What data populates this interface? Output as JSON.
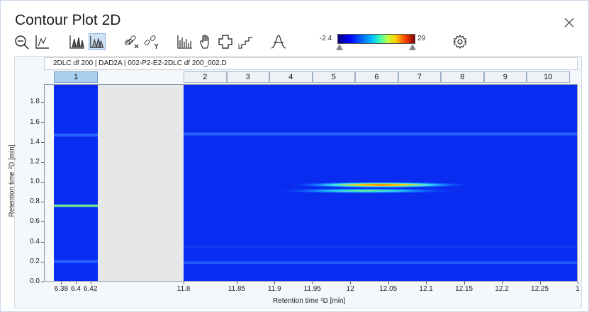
{
  "window": {
    "title": "Contour Plot 2D"
  },
  "toolbar": {
    "buttons": [
      {
        "name": "zoom-out-icon"
      },
      {
        "name": "axis-settings-icon"
      },
      {
        "name": "overlay-peaks-icon"
      },
      {
        "name": "stacked-peaks-icon",
        "active": true
      },
      {
        "name": "link-x-icon"
      },
      {
        "name": "link-y-icon"
      },
      {
        "name": "bar-spectrum-icon"
      },
      {
        "name": "pan-hand-icon"
      },
      {
        "name": "zoom-region-icon"
      },
      {
        "name": "step-icon"
      },
      {
        "name": "peak-icon"
      },
      {
        "name": "gear-icon"
      }
    ],
    "colorbar": {
      "min_label": "-2.4",
      "max_label": "29"
    }
  },
  "plot": {
    "info": "2DLC df 200 | DAD2A | 002-P2-E2-2DLC df 200_002.D",
    "tabs": [
      "1",
      "2",
      "3",
      "4",
      "5",
      "6",
      "7",
      "8",
      "9",
      "10"
    ],
    "selected_tab": "1",
    "ylabel": "Retention time ²D [min]",
    "xlabel": "Retention time ¹D [min]",
    "yticks": [
      "1.8",
      "1.6",
      "1.4",
      "1.2",
      "1.0",
      "0.8",
      "0.6",
      "0.4",
      "0.2",
      "0.0"
    ],
    "xticks_left": [
      "6.38",
      "6.4",
      "6.42"
    ],
    "xticks_right": [
      "11.8",
      "11.85",
      "11.9",
      "11.95",
      "12",
      "12.05",
      "12.1",
      "12.15",
      "12.2",
      "12.25",
      "1"
    ]
  },
  "chart_data": {
    "type": "heatmap",
    "xlabel": "Retention time ¹D [min]",
    "ylabel": "Retention time ²D [min]",
    "ylim": [
      0.0,
      1.98
    ],
    "color_range": [
      -2.4,
      29
    ],
    "segments": [
      {
        "tab": "1",
        "xlim": [
          6.37,
          6.43
        ]
      },
      {
        "tab": "2-10",
        "xlim": [
          11.78,
          12.3
        ]
      }
    ],
    "bands": [
      {
        "segment": "1",
        "y": 0.76,
        "intensity": "medium-high"
      },
      {
        "segment": "1",
        "y": 1.47,
        "intensity": "low"
      },
      {
        "segment": "1",
        "y": 0.2,
        "intensity": "low"
      },
      {
        "segment": "2-10",
        "y": 0.97,
        "x_range": [
          11.95,
          12.12
        ],
        "peak_x": 12.04,
        "intensity": "high"
      },
      {
        "segment": "2-10",
        "y": 0.91,
        "x_range": [
          11.9,
          12.15
        ],
        "intensity": "medium"
      },
      {
        "segment": "2-10",
        "y": 1.48,
        "intensity": "low"
      },
      {
        "segment": "2-10",
        "y": 0.19,
        "intensity": "low"
      }
    ]
  }
}
